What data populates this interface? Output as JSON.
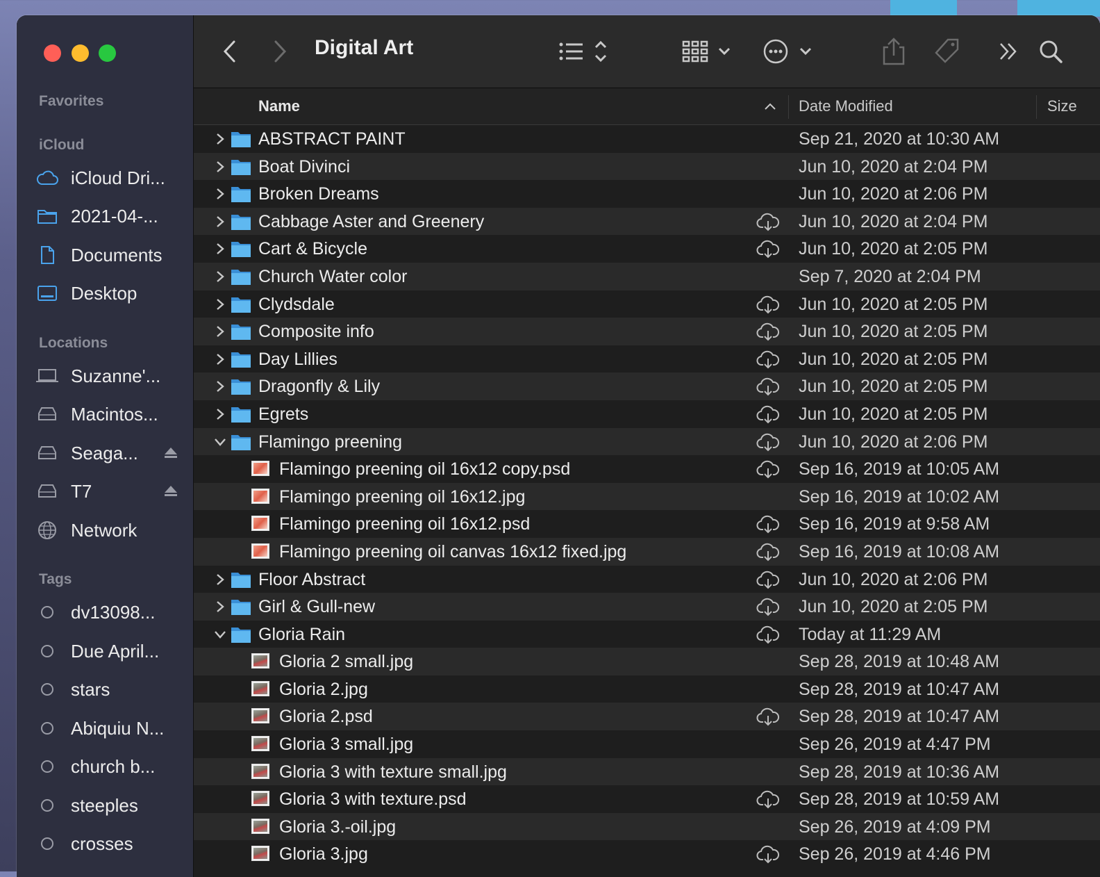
{
  "window": {
    "title": "Digital Art"
  },
  "colors": {
    "accent": "#4aa3ec",
    "folder": "#5fb8f0",
    "close": "#ff5f57",
    "minimize": "#febc2e",
    "zoom": "#28c840"
  },
  "sidebar": {
    "favorites_label": "Favorites",
    "icloud_label": "iCloud",
    "icloud_items": [
      {
        "label": "iCloud Dri...",
        "icon": "cloud-icon"
      },
      {
        "label": "2021-04-...",
        "icon": "folder-icon"
      },
      {
        "label": "Documents",
        "icon": "document-icon"
      },
      {
        "label": "Desktop",
        "icon": "desktop-icon"
      }
    ],
    "locations_label": "Locations",
    "location_items": [
      {
        "label": "Suzanne'...",
        "icon": "laptop-icon"
      },
      {
        "label": "Macintos...",
        "icon": "disk-icon"
      },
      {
        "label": "Seaga...",
        "icon": "disk-icon",
        "eject": true
      },
      {
        "label": "T7",
        "icon": "disk-icon",
        "eject": true
      },
      {
        "label": "Network",
        "icon": "network-icon"
      }
    ],
    "tags_label": "Tags",
    "tag_items": [
      {
        "label": "dv13098..."
      },
      {
        "label": "Due April..."
      },
      {
        "label": "stars"
      },
      {
        "label": "Abiquiu N..."
      },
      {
        "label": "church b..."
      },
      {
        "label": "steeples"
      },
      {
        "label": "crosses"
      }
    ]
  },
  "columns": {
    "name": "Name",
    "date": "Date Modified",
    "size": "Size"
  },
  "files": [
    {
      "name": "ABSTRACT PAINT",
      "date": "Sep 21, 2020 at 10:30 AM",
      "type": "folder",
      "expanded": false,
      "cloud": false
    },
    {
      "name": "Boat Divinci",
      "date": "Jun 10, 2020 at 2:04 PM",
      "type": "folder",
      "expanded": false,
      "cloud": false
    },
    {
      "name": "Broken Dreams",
      "date": "Jun 10, 2020 at 2:06 PM",
      "type": "folder",
      "expanded": false,
      "cloud": false
    },
    {
      "name": "Cabbage Aster and Greenery",
      "date": "Jun 10, 2020 at 2:04 PM",
      "type": "folder",
      "expanded": false,
      "cloud": true
    },
    {
      "name": "Cart & Bicycle",
      "date": "Jun 10, 2020 at 2:05 PM",
      "type": "folder",
      "expanded": false,
      "cloud": true
    },
    {
      "name": "Church Water color",
      "date": "Sep 7, 2020 at 2:04 PM",
      "type": "folder",
      "expanded": false,
      "cloud": false
    },
    {
      "name": "Clydsdale",
      "date": "Jun 10, 2020 at 2:05 PM",
      "type": "folder",
      "expanded": false,
      "cloud": true
    },
    {
      "name": "Composite info",
      "date": "Jun 10, 2020 at 2:05 PM",
      "type": "folder",
      "expanded": false,
      "cloud": true
    },
    {
      "name": "Day Lillies",
      "date": "Jun 10, 2020 at 2:05 PM",
      "type": "folder",
      "expanded": false,
      "cloud": true
    },
    {
      "name": "Dragonfly & Lily",
      "date": "Jun 10, 2020 at 2:05 PM",
      "type": "folder",
      "expanded": false,
      "cloud": true
    },
    {
      "name": "Egrets",
      "date": "Jun 10, 2020 at 2:05 PM",
      "type": "folder",
      "expanded": false,
      "cloud": true
    },
    {
      "name": "Flamingo preening",
      "date": "Jun 10, 2020 at 2:06 PM",
      "type": "folder",
      "expanded": true,
      "cloud": true
    },
    {
      "name": "Flamingo preening oil 16x12 copy.psd",
      "date": "Sep 16, 2019 at 10:05 AM",
      "type": "flamingo",
      "cloud": true
    },
    {
      "name": "Flamingo preening oil 16x12.jpg",
      "date": "Sep 16, 2019 at 10:02 AM",
      "type": "flamingo",
      "cloud": false
    },
    {
      "name": "Flamingo preening oil 16x12.psd",
      "date": "Sep 16, 2019 at 9:58 AM",
      "type": "flamingo",
      "cloud": true
    },
    {
      "name": "Flamingo preening oil canvas 16x12 fixed.jpg",
      "date": "Sep 16, 2019 at 10:08 AM",
      "type": "flamingo",
      "cloud": true
    },
    {
      "name": "Floor Abstract",
      "date": "Jun 10, 2020 at 2:06 PM",
      "type": "folder",
      "expanded": false,
      "cloud": true
    },
    {
      "name": "Girl & Gull-new",
      "date": "Jun 10, 2020 at 2:05 PM",
      "type": "folder",
      "expanded": false,
      "cloud": true
    },
    {
      "name": "Gloria Rain",
      "date": "Today at 11:29 AM",
      "type": "folder",
      "expanded": true,
      "cloud": true
    },
    {
      "name": "Gloria 2 small.jpg",
      "date": "Sep 28, 2019 at 10:48 AM",
      "type": "gloria",
      "cloud": false
    },
    {
      "name": "Gloria 2.jpg",
      "date": "Sep 28, 2019 at 10:47 AM",
      "type": "gloria",
      "cloud": false
    },
    {
      "name": "Gloria 2.psd",
      "date": "Sep 28, 2019 at 10:47 AM",
      "type": "gloria",
      "cloud": true
    },
    {
      "name": "Gloria 3 small.jpg",
      "date": "Sep 26, 2019 at 4:47 PM",
      "type": "gloria",
      "cloud": false
    },
    {
      "name": "Gloria 3 with texture small.jpg",
      "date": "Sep 28, 2019 at 10:36 AM",
      "type": "gloria",
      "cloud": false
    },
    {
      "name": "Gloria 3 with texture.psd",
      "date": "Sep 28, 2019 at 10:59 AM",
      "type": "gloria",
      "cloud": true
    },
    {
      "name": "Gloria 3.-oil.jpg",
      "date": "Sep 26, 2019 at 4:09 PM",
      "type": "gloria",
      "cloud": false
    },
    {
      "name": "Gloria 3.jpg",
      "date": "Sep 26, 2019 at 4:46 PM",
      "type": "gloria",
      "cloud": true
    }
  ]
}
